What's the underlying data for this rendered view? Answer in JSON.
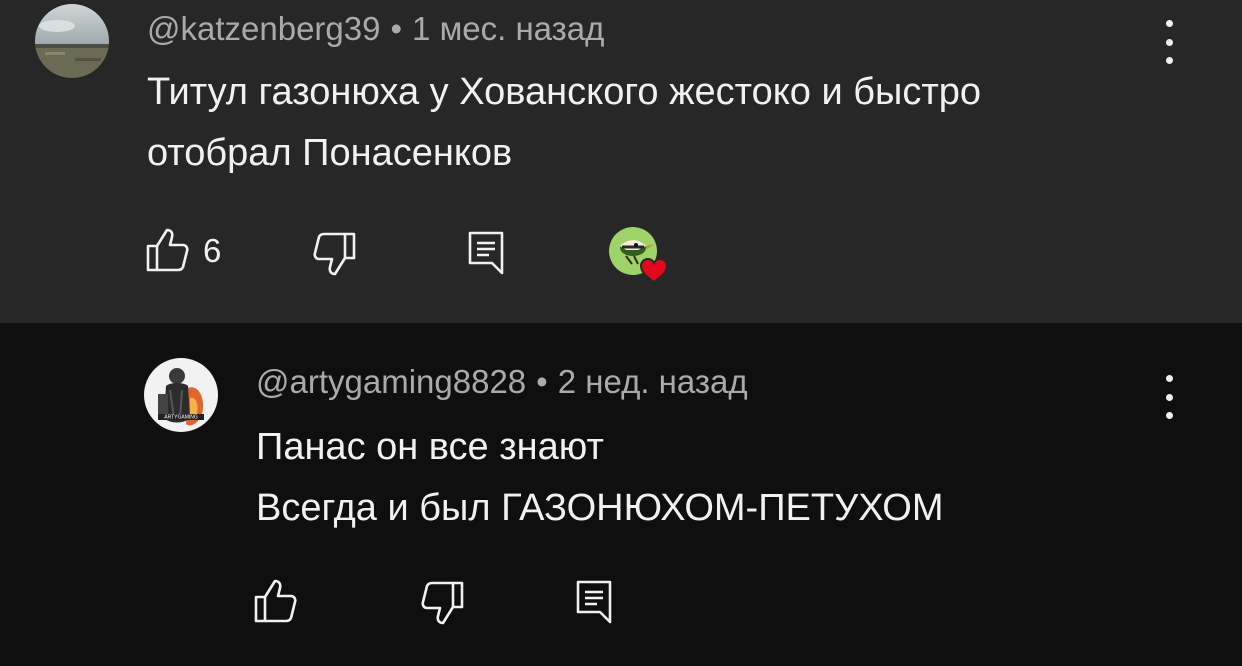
{
  "comments": [
    {
      "username": "@katzenberg39",
      "separator": "•",
      "time": "1 мес. назад",
      "lines": [
        "Титул газонюха у Хованского жестоко и быстро",
        "отобрал Понасенков"
      ],
      "likes": "6"
    },
    {
      "username": "@artygaming8828",
      "separator": "•",
      "time": "2 нед. назад",
      "lines": [
        "Панас он все знают",
        "Всегда и был ГАЗОНЮХОМ-ПЕТУХОМ"
      ],
      "avatar_text": "ARTYGAMING"
    }
  ],
  "icons": {
    "like": "thumbs-up-icon",
    "dislike": "thumbs-down-icon",
    "reply": "reply-icon",
    "menu": "more-vert-icon",
    "creator_heart": "creator-heart-icon"
  },
  "colors": {
    "comment1_bg": "#272727",
    "comment2_bg": "#0f0f0f",
    "heart": "#e3081d"
  }
}
